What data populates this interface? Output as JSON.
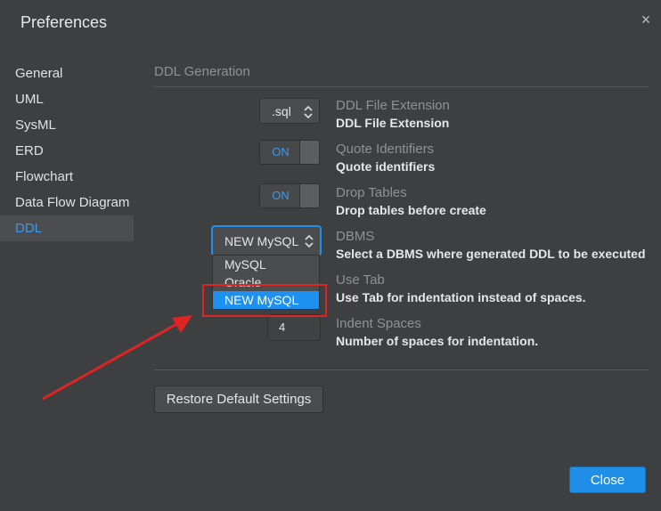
{
  "window": {
    "title": "Preferences",
    "close_glyph": "×"
  },
  "sidebar": {
    "items": [
      {
        "label": "General",
        "active": false
      },
      {
        "label": "UML",
        "active": false
      },
      {
        "label": "SysML",
        "active": false
      },
      {
        "label": "ERD",
        "active": false
      },
      {
        "label": "Flowchart",
        "active": false
      },
      {
        "label": "Data Flow Diagram",
        "active": false
      },
      {
        "label": "DDL",
        "active": true
      }
    ]
  },
  "section": {
    "title": "DDL Generation"
  },
  "settings": {
    "ddl_extension": {
      "value": ".sql",
      "label": "DDL File Extension",
      "description": "DDL File Extension"
    },
    "quote_identifiers": {
      "state": "ON",
      "label": "Quote Identifiers",
      "description": "Quote identifiers"
    },
    "drop_tables": {
      "state": "ON",
      "label": "Drop Tables",
      "description": "Drop tables before create"
    },
    "dbms": {
      "value": "NEW MySQL",
      "label": "DBMS",
      "description": "Select a DBMS where generated DDL to be executed",
      "options": [
        "MySQL",
        "Oracle",
        "NEW MySQL"
      ],
      "selected_option": "NEW MySQL"
    },
    "use_tab": {
      "label": "Use Tab",
      "description": "Use Tab for indentation instead of spaces."
    },
    "indent_spaces": {
      "value": "4",
      "label": "Indent Spaces",
      "description": "Number of spaces for indentation."
    }
  },
  "buttons": {
    "restore": "Restore Default Settings",
    "close": "Close"
  },
  "colors": {
    "accent": "#1e90f0",
    "annotation": "#e02424",
    "background": "#3d3f41"
  }
}
